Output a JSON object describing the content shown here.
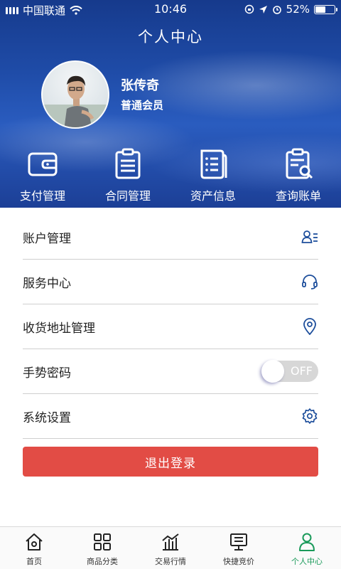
{
  "status_bar": {
    "carrier": "中国联通",
    "time": "10:46",
    "battery_text": "52%",
    "battery_level": 0.52
  },
  "header": {
    "title": "个人中心"
  },
  "profile": {
    "name": "张传奇",
    "level": "普通会员"
  },
  "quick_actions": [
    {
      "label": "支付管理",
      "icon": "wallet-icon"
    },
    {
      "label": "合同管理",
      "icon": "clipboard-icon"
    },
    {
      "label": "资产信息",
      "icon": "document-list-icon"
    },
    {
      "label": "查询账单",
      "icon": "bill-search-icon"
    }
  ],
  "menu": {
    "account": {
      "label": "账户管理",
      "icon": "user-list-icon"
    },
    "service": {
      "label": "服务中心",
      "icon": "headset-icon"
    },
    "address": {
      "label": "收货地址管理",
      "icon": "location-pin-icon"
    },
    "gesture": {
      "label": "手势密码",
      "toggle_text": "OFF",
      "enabled": false
    },
    "settings": {
      "label": "系统设置",
      "icon": "gear-icon"
    }
  },
  "logout_label": "退出登录",
  "tabbar": {
    "items": [
      {
        "label": "首页",
        "icon": "home-icon"
      },
      {
        "label": "商品分类",
        "icon": "grid-icon"
      },
      {
        "label": "交易行情",
        "icon": "chart-icon"
      },
      {
        "label": "快捷竞价",
        "icon": "monitor-icon"
      },
      {
        "label": "个人中心",
        "icon": "person-icon",
        "active": true
      }
    ]
  },
  "colors": {
    "accent_icon": "#1e4f9c",
    "logout_red": "#e24c45",
    "active_tab": "#1a9a5a"
  }
}
